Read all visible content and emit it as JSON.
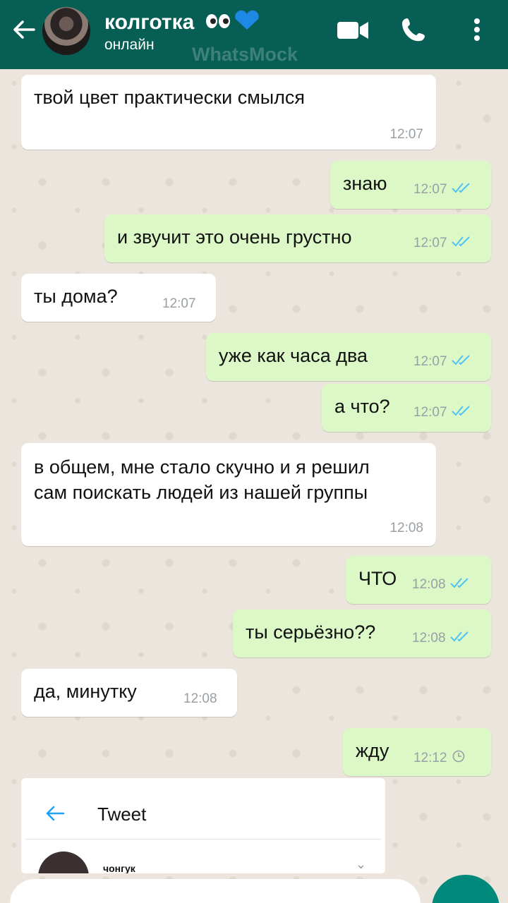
{
  "header": {
    "contact_name": "колготка",
    "status": "онлайн",
    "watermark": "WhatsMock"
  },
  "messages": [
    {
      "dir": "in",
      "text": "твой цвет практически смылся",
      "time": "12:07"
    },
    {
      "dir": "out",
      "text": "знаю",
      "time": "12:07",
      "status": "read"
    },
    {
      "dir": "out",
      "text": "и звучит это очень грустно",
      "time": "12:07",
      "status": "read"
    },
    {
      "dir": "in",
      "text": "ты дома?",
      "time": "12:07"
    },
    {
      "dir": "out",
      "text": "уже как часа два",
      "time": "12:07",
      "status": "read"
    },
    {
      "dir": "out",
      "text": "а что?",
      "time": "12:07",
      "status": "read"
    },
    {
      "dir": "in",
      "text": "в общем, мне стало скучно и я решил сам поискать людей из нашей группы",
      "time": "12:08"
    },
    {
      "dir": "out",
      "text": "ЧТО",
      "time": "12:08",
      "status": "read"
    },
    {
      "dir": "out",
      "text": "ты серьёзно??",
      "time": "12:08",
      "status": "read"
    },
    {
      "dir": "in",
      "text": "да, минутку",
      "time": "12:08"
    },
    {
      "dir": "out",
      "text": "жду",
      "time": "12:12",
      "status": "pending"
    }
  ],
  "tweet_card": {
    "title": "Tweet",
    "author": "чонгук"
  },
  "colors": {
    "header": "#075e54",
    "outgoing_bubble": "#dcf8c6",
    "incoming_bubble": "#ffffff",
    "read_ticks": "#4fc3f7",
    "send_button": "#00897b"
  },
  "icons": [
    "back-arrow-icon",
    "video-call-icon",
    "phone-icon",
    "more-vert-icon",
    "double-check-icon",
    "clock-icon"
  ]
}
